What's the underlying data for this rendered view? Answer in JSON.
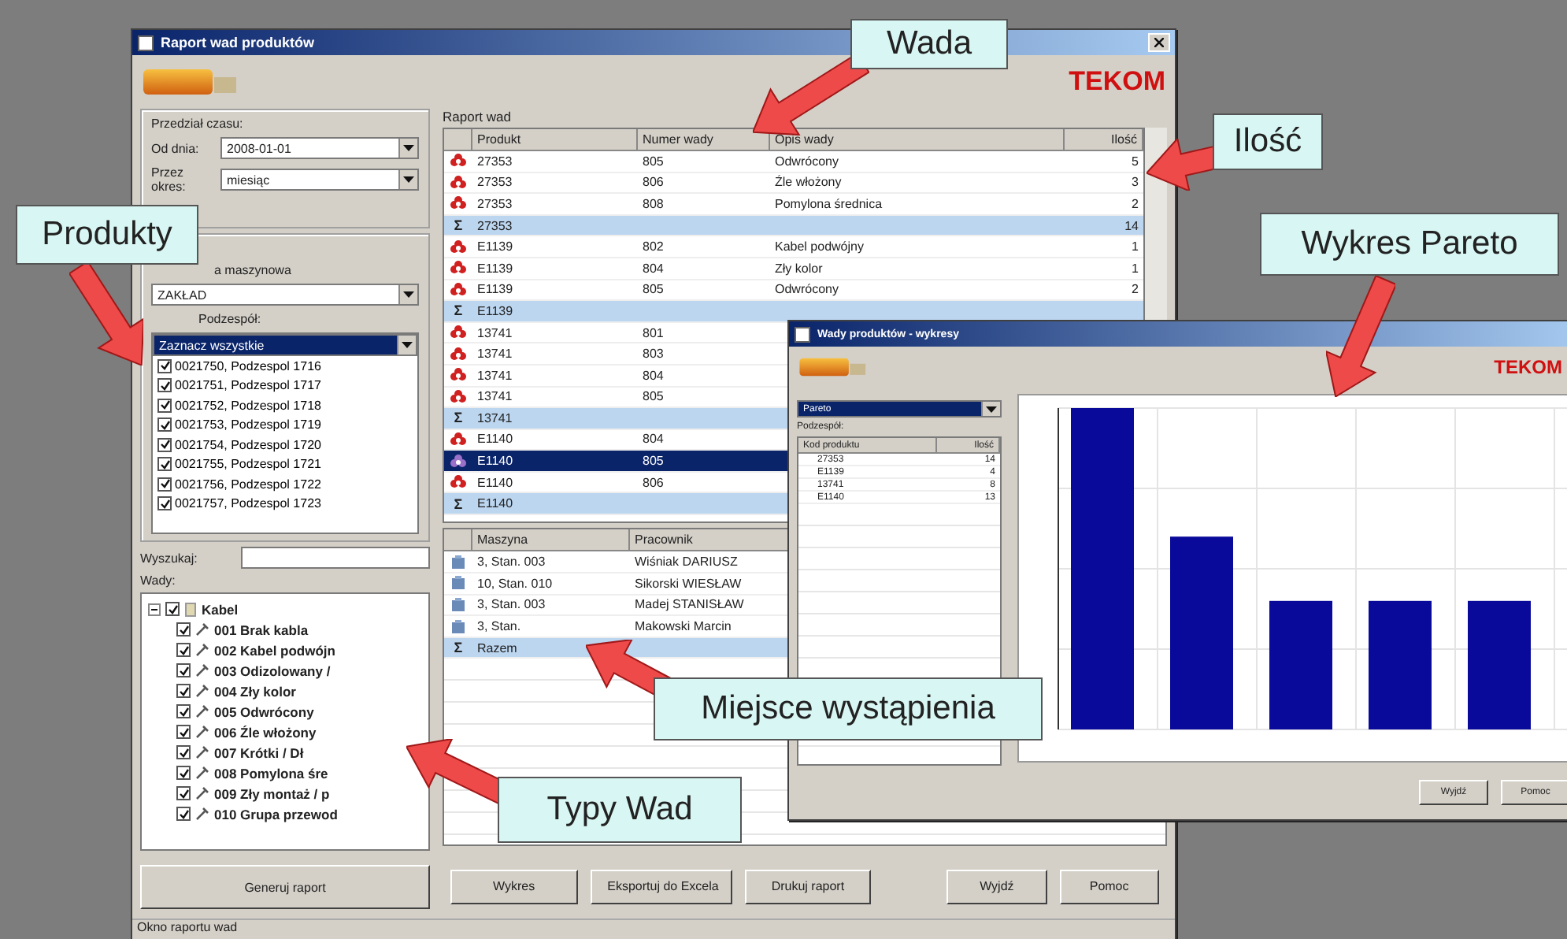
{
  "main_window": {
    "title": "Raport wad produktów",
    "brand": "TEKOM",
    "time_range": {
      "title": "Przedział czasu:",
      "from_label": "Od dnia:",
      "from_value": "2008-01-01",
      "period_label": "Przez okres:",
      "period_value": "miesiąc"
    },
    "products": {
      "group_label": "a maszynowa",
      "group_value": "ZAKŁAD",
      "subassembly_label": "Podzespół:",
      "select_all": {
        "label": "Zaznacz wszystkie",
        "selected": true
      },
      "items": [
        {
          "label": "0021750, Podzespol 1716",
          "checked": true
        },
        {
          "label": "0021751, Podzespol 1717",
          "checked": true
        },
        {
          "label": "0021752, Podzespol 1718",
          "checked": true
        },
        {
          "label": "0021753, Podzespol 1719",
          "checked": true
        },
        {
          "label": "0021754, Podzespol 1720",
          "checked": true
        },
        {
          "label": "0021755, Podzespol 1721",
          "checked": true
        },
        {
          "label": "0021756, Podzespol 1722",
          "checked": true
        },
        {
          "label": "0021757, Podzespol 1723",
          "checked": true
        }
      ]
    },
    "search": {
      "label": "Wyszukaj:"
    },
    "defects": {
      "label": "Wady:",
      "tree": [
        {
          "label": "Kabel",
          "checked": true,
          "expanded": true,
          "children": [
            {
              "label": "001 Brak kabla",
              "checked": true
            },
            {
              "label": "002 Kabel podwójn",
              "checked": true
            },
            {
              "label": "003 Odizolowany / ",
              "checked": true
            },
            {
              "label": "004 Zły kolor",
              "checked": true
            },
            {
              "label": "005 Odwrócony",
              "checked": true
            },
            {
              "label": "006 Źle włożony",
              "checked": true
            },
            {
              "label": "007 Krótki / Dł",
              "checked": true
            },
            {
              "label": "008 Pomylona śre",
              "checked": true
            },
            {
              "label": "009 Zły montaż / p",
              "checked": true
            },
            {
              "label": "010 Grupa przewod",
              "checked": true
            }
          ]
        }
      ]
    },
    "generate_button": "Generuj raport",
    "report": {
      "title": "Raport wad",
      "columns": [
        "Produkt",
        "Numer wady",
        "Opis wady",
        "Ilość"
      ],
      "rows": [
        {
          "kind": "defect",
          "product": "27353",
          "number": "805",
          "description": "Odwrócony",
          "count": "5",
          "selected": false
        },
        {
          "kind": "defect",
          "product": "27353",
          "number": "806",
          "description": "Źle włożony",
          "count": "3",
          "selected": false
        },
        {
          "kind": "defect",
          "product": "27353",
          "number": "808",
          "description": "Pomylona średnica",
          "count": "2",
          "selected": false
        },
        {
          "kind": "sum",
          "symbol": "Σ",
          "product": "27353",
          "count": "14",
          "selected": false
        },
        {
          "kind": "defect",
          "product": "E1139",
          "number": "802",
          "description": "Kabel podwójny",
          "count": "1",
          "selected": false
        },
        {
          "kind": "defect",
          "product": "E1139",
          "number": "804",
          "description": "Zły kolor",
          "count": "1",
          "selected": false
        },
        {
          "kind": "defect",
          "product": "E1139",
          "number": "805",
          "description": "Odwrócony",
          "count": "2",
          "selected": false
        },
        {
          "kind": "sum",
          "symbol": "Σ",
          "product": "E1139",
          "selected": false
        },
        {
          "kind": "defect",
          "product": "13741",
          "number": "801",
          "selected": false
        },
        {
          "kind": "defect",
          "product": "13741",
          "number": "803",
          "selected": false
        },
        {
          "kind": "defect",
          "product": "13741",
          "number": "804",
          "selected": false
        },
        {
          "kind": "defect",
          "product": "13741",
          "number": "805",
          "selected": false
        },
        {
          "kind": "sum",
          "symbol": "Σ",
          "product": "13741",
          "selected": false
        },
        {
          "kind": "defect",
          "product": "E1140",
          "number": "804",
          "selected": false
        },
        {
          "kind": "defect",
          "product": "E1140",
          "number": "805",
          "selected": true
        },
        {
          "kind": "defect",
          "product": "E1140",
          "number": "806",
          "selected": false
        },
        {
          "kind": "sum",
          "symbol": "Σ",
          "product": "E1140",
          "selected": false
        }
      ]
    },
    "locations": {
      "columns": [
        "Maszyna",
        "Pracownik"
      ],
      "rows": [
        {
          "kind": "location",
          "machine": "3, Stan. 003",
          "worker": "Wiśniak DARIUSZ"
        },
        {
          "kind": "location",
          "machine": "10, Stan. 010",
          "worker": "Sikorski WIESŁAW"
        },
        {
          "kind": "location",
          "machine": "3, Stan. 003",
          "worker": "Madej STANISŁAW"
        },
        {
          "kind": "location",
          "machine": "3, Stan.",
          "worker": "Makowski Marcin"
        },
        {
          "kind": "sum",
          "symbol": "Σ",
          "machine": "Razem"
        }
      ]
    },
    "buttons": [
      "Wykres",
      "Eksportuj do Excela",
      "Drukuj raport",
      "Wyjdź",
      "Pomoc"
    ],
    "status_bar": "Okno raportu wad"
  },
  "chart_window": {
    "title": "Wady produktów - wykresy",
    "brand": "TEKOM",
    "chart_type": "Pareto",
    "list_label": "Podzespół:",
    "columns": [
      "Kod produktu",
      "Ilość"
    ],
    "rows": [
      {
        "code": "27353",
        "count": "14"
      },
      {
        "code": "E1139",
        "count": "4"
      },
      {
        "code": "13741",
        "count": "8"
      },
      {
        "code": "E1140",
        "count": "13"
      }
    ],
    "buttons": [
      "Wyjdź",
      "Pomoc"
    ]
  },
  "callouts": [
    {
      "text": "Wada"
    },
    {
      "text": "Ilość"
    },
    {
      "text": "Produkty"
    },
    {
      "text": "Wykres Pareto"
    },
    {
      "text": "Miejsce wystąpienia"
    },
    {
      "text": "Typy Wad"
    }
  ]
}
